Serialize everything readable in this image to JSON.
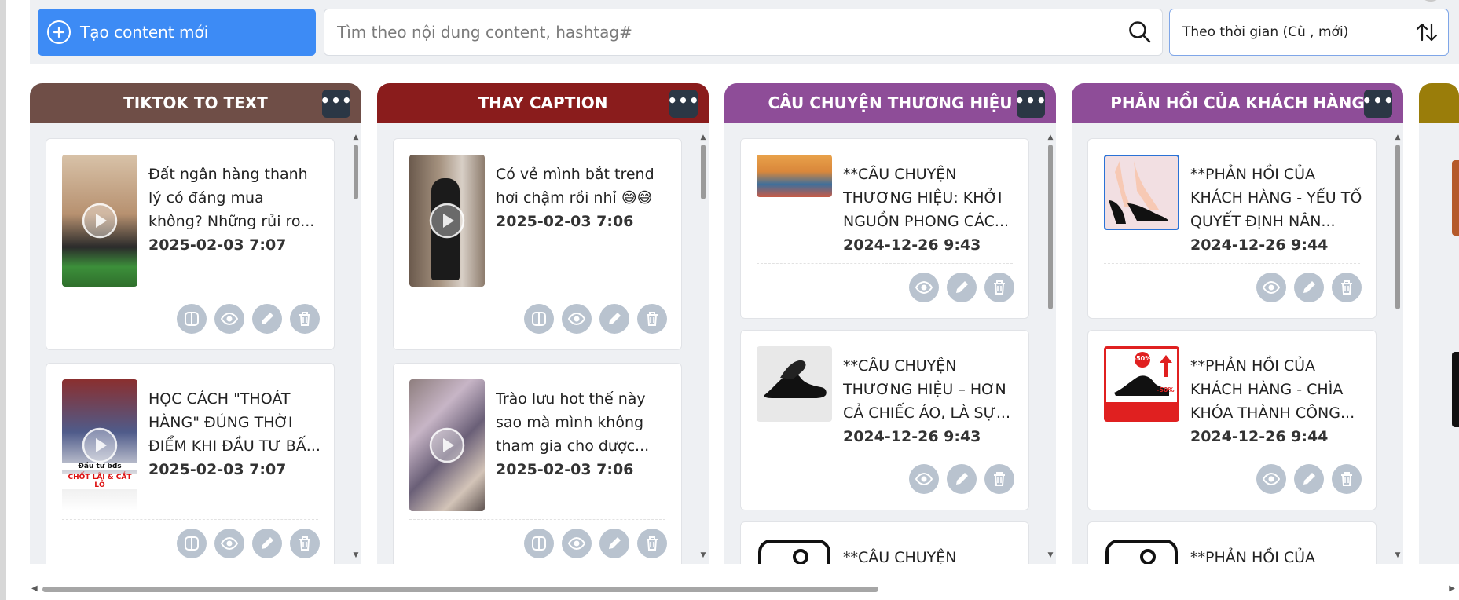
{
  "toolbar": {
    "create_button_label": "Tạo content mới",
    "search_placeholder": "Tìm theo nội dung content, hashtag#",
    "sort_label": "Theo thời gian (Cũ , mới)"
  },
  "columns": [
    {
      "title": "TIKTOK TO TEXT",
      "color": "#6f4e47",
      "cards": [
        {
          "title": "Đất ngân hàng thanh lý có đáng mua không? Những rủi ro...",
          "date": "2025-02-03 7:07",
          "thumb_icon": "video-play-icon",
          "actions": [
            "split-icon",
            "eye-icon",
            "pencil-icon",
            "trash-icon"
          ]
        },
        {
          "title": "HỌC CÁCH \"THOÁT HÀNG\" ĐÚNG THỜI ĐIỂM KHI ĐẦU TƯ BẤ...",
          "date": "2025-02-03 7:07",
          "thumb_icon": "video-play-icon",
          "thumb_caption_1": "Đầu tư bđs",
          "thumb_caption_2": "CHỐT LÃI & CẮT LỖ",
          "actions": [
            "split-icon",
            "eye-icon",
            "pencil-icon",
            "trash-icon"
          ]
        }
      ]
    },
    {
      "title": "THAY CAPTION",
      "color": "#8a1c1c",
      "cards": [
        {
          "title": "Có vẻ mình bắt trend hơi chậm rồi nhỉ 😅😅",
          "date": "2025-02-03 7:06",
          "thumb_icon": "video-play-icon",
          "actions": [
            "split-icon",
            "eye-icon",
            "pencil-icon",
            "trash-icon"
          ]
        },
        {
          "title": "Trào lưu hot thế này sao mà mình không tham gia cho được...",
          "date": "2025-02-03 7:06",
          "thumb_icon": "video-play-icon",
          "actions": [
            "split-icon",
            "eye-icon",
            "pencil-icon",
            "trash-icon"
          ]
        }
      ]
    },
    {
      "title": "CÂU CHUYỆN THƯƠNG HIỆU",
      "color": "#8e4d98",
      "cards": [
        {
          "title": "**CÂU CHUYỆN THƯƠNG HIỆU: KHỞI NGUỒN PHONG CÁC...",
          "date": "2024-12-26 9:43",
          "actions": [
            "eye-icon",
            "pencil-icon",
            "trash-icon"
          ]
        },
        {
          "title": "**CÂU CHUYỆN THƯƠNG HIỆU – HƠN CẢ CHIẾC ÁO, LÀ SỰ...",
          "date": "2024-12-26 9:43",
          "actions": [
            "eye-icon",
            "pencil-icon",
            "trash-icon"
          ]
        },
        {
          "title": "**CÂU CHUYỆN",
          "date": "",
          "actions": []
        }
      ]
    },
    {
      "title": "PHẢN HỒI CỦA KHÁCH HÀNG",
      "color": "#8e4d98",
      "cards": [
        {
          "title": "**PHẢN HỒI CỦA KHÁCH HÀNG - YẾU TỐ QUYẾT ĐỊNH NÂN...",
          "date": "2024-12-26 9:44",
          "actions": [
            "eye-icon",
            "pencil-icon",
            "trash-icon"
          ]
        },
        {
          "title": "**PHẢN HỒI CỦA KHÁCH HÀNG - CHÌA KHÓA THÀNH CÔNG...",
          "date": "2024-12-26 9:44",
          "thumb_badge_1": "-50%",
          "thumb_badge_2": "-50%",
          "actions": [
            "eye-icon",
            "pencil-icon",
            "trash-icon"
          ]
        },
        {
          "title": "**PHẢN HỒI CỦA",
          "date": "",
          "actions": []
        }
      ]
    },
    {
      "title": "",
      "color": "#9a7d0a",
      "cards": []
    }
  ],
  "column_more_label": "•••"
}
